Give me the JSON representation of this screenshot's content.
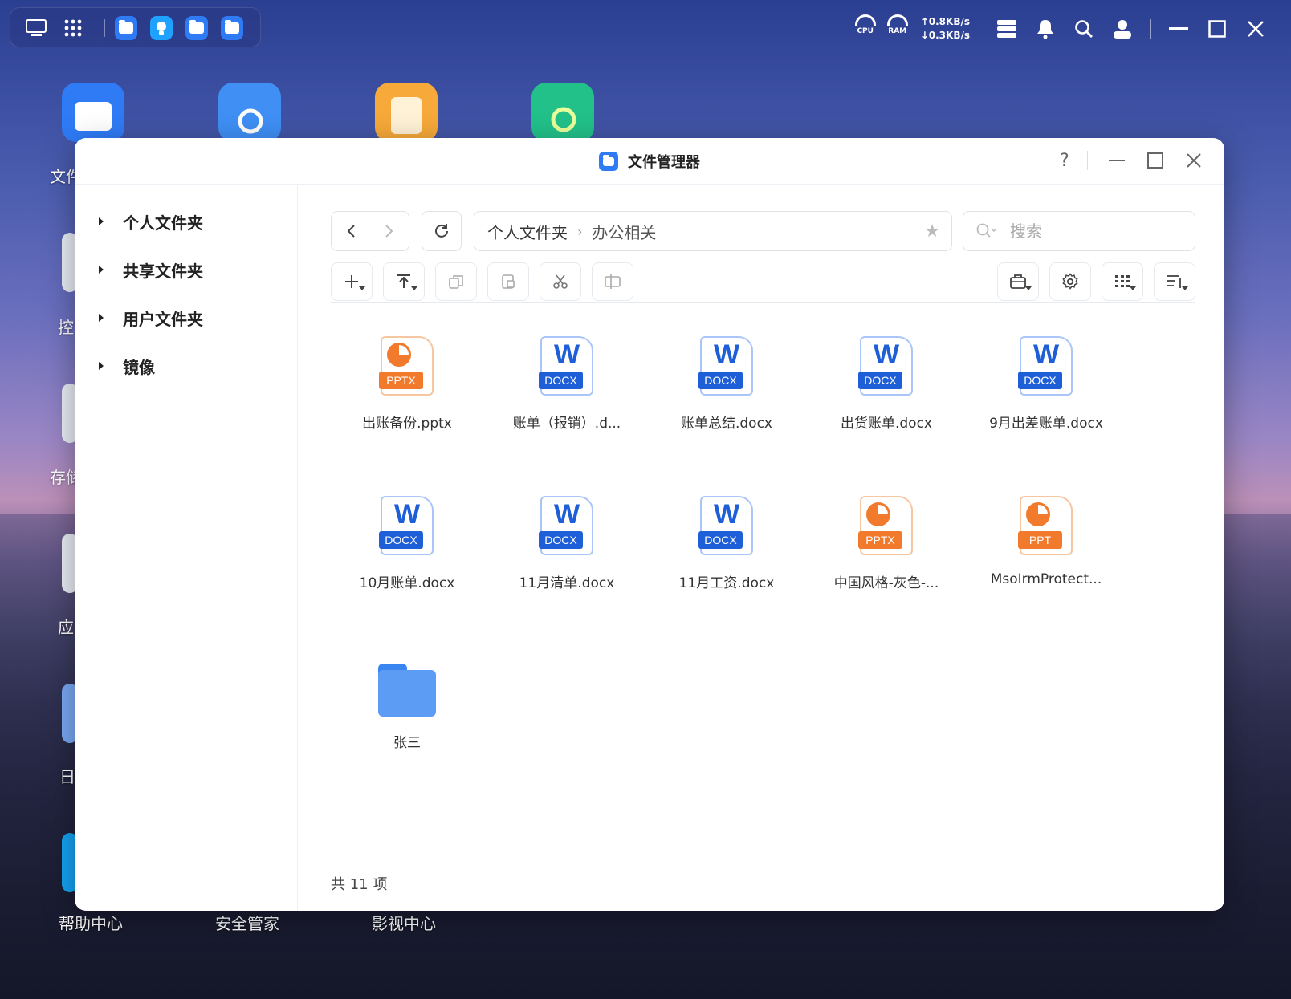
{
  "taskbar": {
    "cpu_label": "CPU",
    "ram_label": "RAM",
    "upload": "↑0.8KB/s",
    "download": "↓0.3KB/s"
  },
  "desktop": {
    "icons": [
      {
        "label": "文件",
        "name": "file-manager"
      },
      {
        "label": "控",
        "name": "control"
      },
      {
        "label": "存储",
        "name": "storage"
      },
      {
        "label": "应",
        "name": "app"
      },
      {
        "label": "日",
        "name": "log"
      },
      {
        "label": "帮助中心",
        "name": "help-center"
      },
      {
        "label": "安全管家",
        "name": "security"
      },
      {
        "label": "影视中心",
        "name": "media-center"
      }
    ]
  },
  "window": {
    "title": "文件管理器",
    "help": "?"
  },
  "sidebar": {
    "items": [
      {
        "label": "个人文件夹"
      },
      {
        "label": "共享文件夹"
      },
      {
        "label": "用户文件夹"
      },
      {
        "label": "镜像"
      }
    ]
  },
  "path": {
    "root": "个人文件夹",
    "current": "办公相关"
  },
  "search": {
    "placeholder": "搜索"
  },
  "files": [
    {
      "name": "出账备份.pptx",
      "type": "pptx",
      "tag": "PPTX"
    },
    {
      "name": "账单（报销）.d...",
      "type": "docx",
      "tag": "DOCX"
    },
    {
      "name": "账单总结.docx",
      "type": "docx",
      "tag": "DOCX"
    },
    {
      "name": "出货账单.docx",
      "type": "docx",
      "tag": "DOCX"
    },
    {
      "name": "9月出差账单.docx",
      "type": "docx",
      "tag": "DOCX"
    },
    {
      "name": "10月账单.docx",
      "type": "docx",
      "tag": "DOCX"
    },
    {
      "name": "11月清单.docx",
      "type": "docx",
      "tag": "DOCX"
    },
    {
      "name": "11月工资.docx",
      "type": "docx",
      "tag": "DOCX"
    },
    {
      "name": "中国风格-灰色-...",
      "type": "pptx",
      "tag": "PPTX"
    },
    {
      "name": "MsoIrmProtect...",
      "type": "pptx",
      "tag": "PPT"
    },
    {
      "name": "张三",
      "type": "folder",
      "tag": ""
    }
  ],
  "footer": {
    "count_text": "共 11 项"
  },
  "colors": {
    "accent": "#2f7bf6",
    "docx": "#1e5fd8",
    "pptx": "#f27a2d"
  }
}
